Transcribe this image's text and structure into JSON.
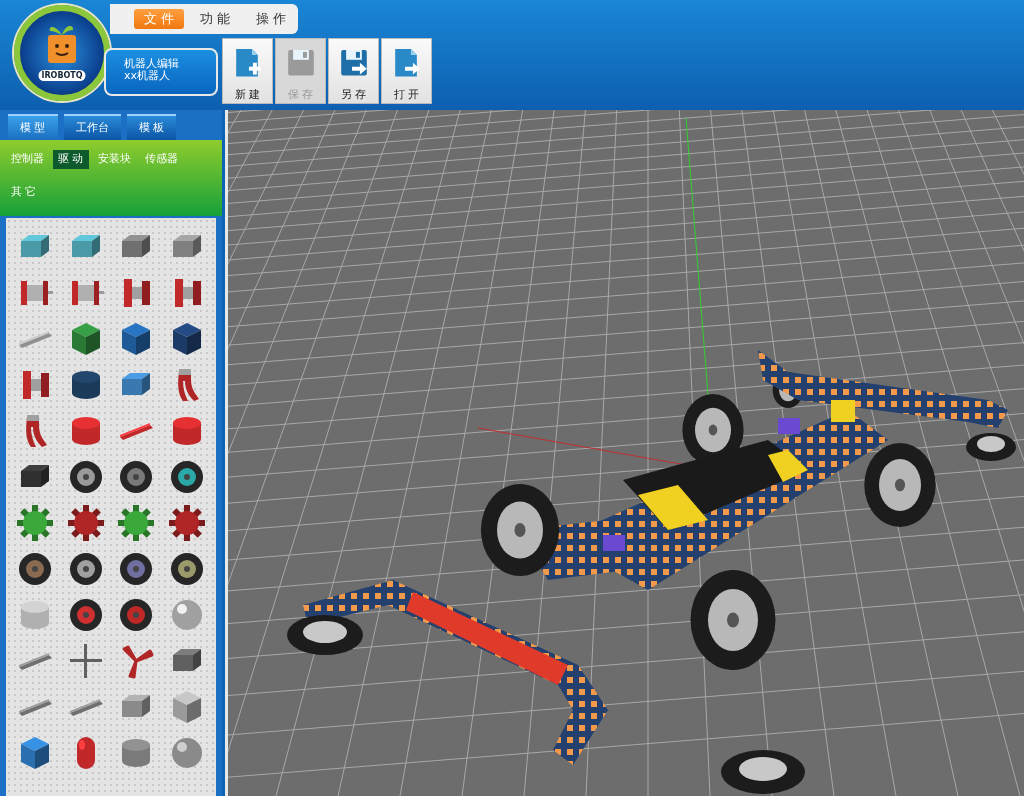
{
  "logo": {
    "text": "IROBOTQ"
  },
  "menu": [
    {
      "label": "文 件",
      "selected": true
    },
    {
      "label": "功 能",
      "selected": false
    },
    {
      "label": "操 作",
      "selected": false
    }
  ],
  "title": {
    "line1": "机器人编辑",
    "line2": "xx机器人"
  },
  "toolbar": [
    {
      "label": "新 建",
      "kind": "new",
      "disabled": false
    },
    {
      "label": "保 存",
      "kind": "save",
      "disabled": true
    },
    {
      "label": "另 存",
      "kind": "save_as",
      "disabled": false
    },
    {
      "label": "打 开",
      "kind": "open",
      "disabled": false
    }
  ],
  "panel_tabs": [
    {
      "label": "模 型",
      "selected": true
    },
    {
      "label": "工作台",
      "selected": false
    },
    {
      "label": "模 板",
      "selected": false
    }
  ],
  "categories": [
    {
      "label": "控制器",
      "selected": false
    },
    {
      "label": "驱 动",
      "selected": true
    },
    {
      "label": "安装块",
      "selected": false
    },
    {
      "label": "传感器",
      "selected": false
    },
    {
      "label": "其 它",
      "selected": false
    }
  ],
  "parts": [
    {
      "kind": "block",
      "color": "#4a9aa8"
    },
    {
      "kind": "block",
      "color": "#4a9aa8"
    },
    {
      "kind": "block",
      "color": "#707070"
    },
    {
      "kind": "block",
      "color": "#808080"
    },
    {
      "kind": "motor",
      "color": "#c0282a"
    },
    {
      "kind": "motor",
      "color": "#c0282a"
    },
    {
      "kind": "bracket",
      "color": "#c0282a"
    },
    {
      "kind": "bracket",
      "color": "#c0282a"
    },
    {
      "kind": "rod",
      "color": "#909090"
    },
    {
      "kind": "cube",
      "color": "#2a7a36"
    },
    {
      "kind": "cube",
      "color": "#1e5a96"
    },
    {
      "kind": "cube",
      "color": "#1c3a66"
    },
    {
      "kind": "bracket",
      "color": "#c0282a"
    },
    {
      "kind": "cylinder",
      "color": "#1c3a5a"
    },
    {
      "kind": "block",
      "color": "#3a78b0"
    },
    {
      "kind": "claw",
      "color": "#b02626"
    },
    {
      "kind": "claw",
      "color": "#b02626"
    },
    {
      "kind": "cylinder",
      "color": "#c0282a"
    },
    {
      "kind": "rod",
      "color": "#c0282a"
    },
    {
      "kind": "cylinder",
      "color": "#c0282a"
    },
    {
      "kind": "block",
      "color": "#303030"
    },
    {
      "kind": "wheel",
      "color": "#9a9a9a"
    },
    {
      "kind": "wheel",
      "color": "#7a7a7a"
    },
    {
      "kind": "wheel",
      "color": "#2aa8a8"
    },
    {
      "kind": "gear",
      "color": "#3aa83a"
    },
    {
      "kind": "gear",
      "color": "#b02626"
    },
    {
      "kind": "gear",
      "color": "#3aa83a"
    },
    {
      "kind": "gear",
      "color": "#b02626"
    },
    {
      "kind": "wheel",
      "color": "#8a6a50"
    },
    {
      "kind": "wheel",
      "color": "#a0a0a0"
    },
    {
      "kind": "wheel",
      "color": "#7070a0"
    },
    {
      "kind": "wheel",
      "color": "#9a9a6a"
    },
    {
      "kind": "cylinder",
      "color": "#b0b0b0"
    },
    {
      "kind": "wheel",
      "color": "#d03030"
    },
    {
      "kind": "wheel",
      "color": "#c02828"
    },
    {
      "kind": "sphere",
      "color": "#a0a0a0"
    },
    {
      "kind": "rod",
      "color": "#707070"
    },
    {
      "kind": "cross",
      "color": "#606060"
    },
    {
      "kind": "propeller",
      "color": "#b02626"
    },
    {
      "kind": "block",
      "color": "#606060"
    },
    {
      "kind": "rod",
      "color": "#707070"
    },
    {
      "kind": "rod",
      "color": "#707070"
    },
    {
      "kind": "block",
      "color": "#8a8a8a"
    },
    {
      "kind": "cube",
      "color": "#9a9a9a"
    },
    {
      "kind": "cube",
      "color": "#2a70b0"
    },
    {
      "kind": "capsule",
      "color": "#c0282a"
    },
    {
      "kind": "cylinder",
      "color": "#7a7a7a"
    },
    {
      "kind": "sphere",
      "color": "#8a8a8a"
    }
  ]
}
